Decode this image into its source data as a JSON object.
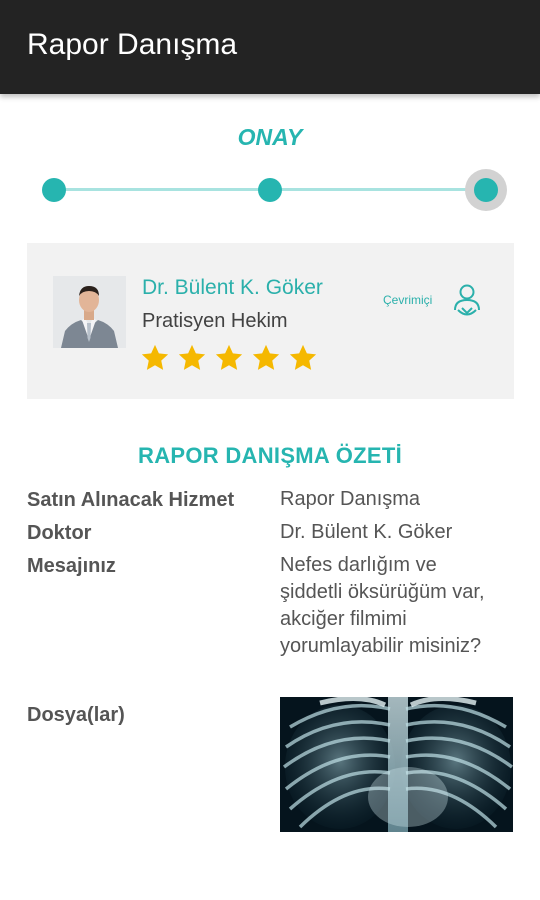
{
  "appbar": {
    "title": "Rapor Danışma"
  },
  "stepper": {
    "label": "ONAY",
    "steps": 3,
    "current": 3
  },
  "doctor": {
    "name": "Dr. Bülent K. Göker",
    "title": "Pratisyen Hekim",
    "rating": 5,
    "rating_max": 5,
    "status": "Çevrimiçi",
    "status_icon": "online-user-icon"
  },
  "summary": {
    "title": "RAPOR DANIŞMA ÖZETİ",
    "rows": [
      {
        "label": "Satın Alınacak Hizmet",
        "value": "Rapor Danışma"
      },
      {
        "label": "Doktor",
        "value": "Dr. Bülent K. Göker"
      },
      {
        "label": "Mesajınız",
        "value": "Nefes darlığım ve şiddetli öksürüğüm var, akciğer filmimi yorumlayabilir misiniz?"
      },
      {
        "label": "Dosya(lar)",
        "value": ""
      }
    ]
  },
  "colors": {
    "accent": "#26b5b0",
    "appbar": "#232323",
    "star": "#f5b800",
    "card": "#f2f2f2"
  }
}
